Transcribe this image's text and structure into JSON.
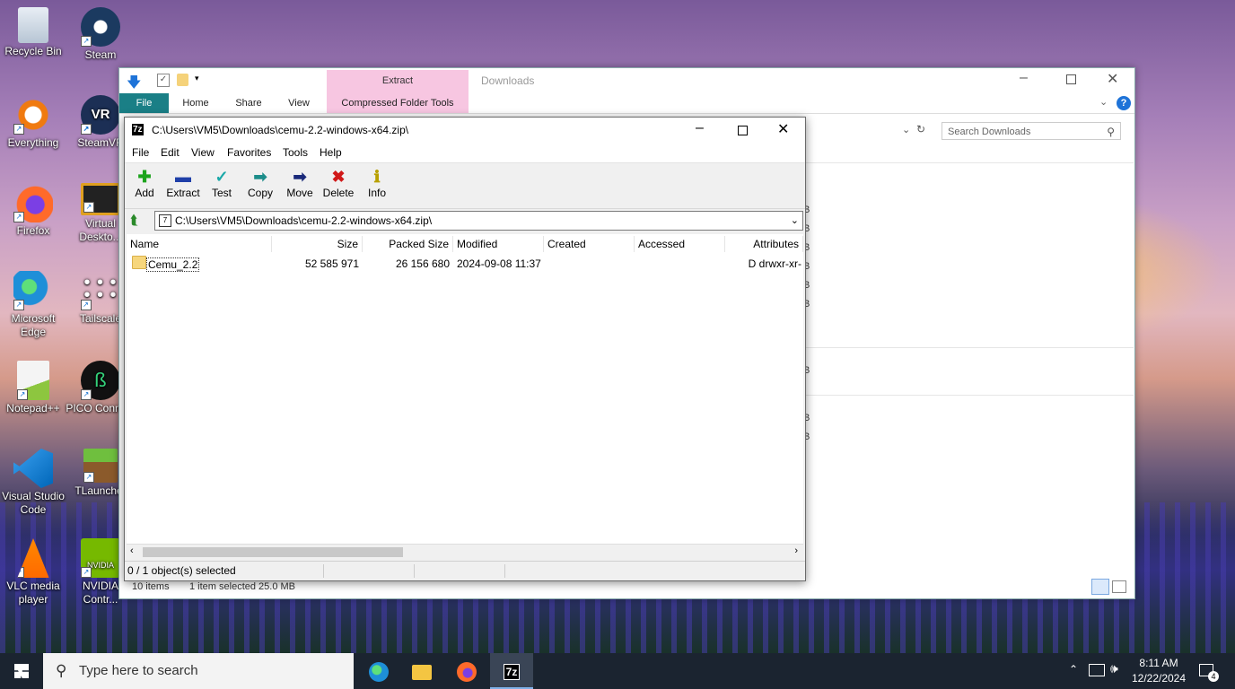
{
  "desktop_icons": [
    {
      "label": "Recycle Bin",
      "icon": "recycle-bin-icon"
    },
    {
      "label": "Steam",
      "icon": "steam-icon"
    },
    {
      "label": "Everything",
      "icon": "everything-search-icon"
    },
    {
      "label": "SteamVR",
      "icon": "steamvr-icon"
    },
    {
      "label": "Firefox",
      "icon": "firefox-icon"
    },
    {
      "label": "Virtual Deskto...",
      "icon": "virtual-desktop-icon"
    },
    {
      "label": "Microsoft Edge",
      "icon": "edge-icon"
    },
    {
      "label": "Tailscale",
      "icon": "tailscale-icon"
    },
    {
      "label": "Notepad++",
      "icon": "notepadpp-icon"
    },
    {
      "label": "PICO Connect",
      "icon": "pico-connect-icon"
    },
    {
      "label": "Visual Studio Code",
      "icon": "vscode-icon"
    },
    {
      "label": "TLauncher",
      "icon": "tlauncher-icon"
    },
    {
      "label": "VLC media player",
      "icon": "vlc-icon"
    },
    {
      "label": "NVIDIA Contr...",
      "icon": "nvidia-icon"
    }
  ],
  "explorer": {
    "title": "Downloads",
    "context_tab": "Extract",
    "tabs": [
      "File",
      "Home",
      "Share",
      "View",
      "Compressed Folder Tools"
    ],
    "search_placeholder": "Search Downloads",
    "size_fragments": [
      "B",
      "B",
      "B",
      "B",
      "B",
      "B",
      "B",
      "B",
      "B"
    ],
    "status_items": "10 items",
    "status_selected": "1 item selected  25.0 MB"
  },
  "zip": {
    "title": "C:\\Users\\VM5\\Downloads\\cemu-2.2-windows-x64.zip\\",
    "app_badge": "7z",
    "menu": [
      "File",
      "Edit",
      "View",
      "Favorites",
      "Tools",
      "Help"
    ],
    "toolbar": [
      {
        "label": "Add",
        "icon": "add-icon",
        "glyph": "✚",
        "color": "#1da41d"
      },
      {
        "label": "Extract",
        "icon": "extract-icon",
        "glyph": "▬",
        "color": "#1f3fa8"
      },
      {
        "label": "Test",
        "icon": "test-icon",
        "glyph": "✓",
        "color": "#1aa8a8"
      },
      {
        "label": "Copy",
        "icon": "copy-icon",
        "glyph": "➡",
        "color": "#1c8d8a"
      },
      {
        "label": "Move",
        "icon": "move-icon",
        "glyph": "➡",
        "color": "#1a2a7a"
      },
      {
        "label": "Delete",
        "icon": "delete-icon",
        "glyph": "✖",
        "color": "#d01818"
      },
      {
        "label": "Info",
        "icon": "info-icon",
        "glyph": "ℹ",
        "color": "#b8a000"
      }
    ],
    "address": "C:\\Users\\VM5\\Downloads\\cemu-2.2-windows-x64.zip\\",
    "columns": [
      "Name",
      "Size",
      "Packed Size",
      "Modified",
      "Created",
      "Accessed",
      "Attributes"
    ],
    "rows": [
      {
        "name": "Cemu_2.2",
        "size": "52 585 971",
        "packed": "26 156 680",
        "modified": "2024-09-08 11:37",
        "created": "",
        "accessed": "",
        "attributes": "D drwxr-xr-"
      }
    ],
    "status": "0 / 1 object(s) selected"
  },
  "taskbar": {
    "search_placeholder": "Type here to search",
    "time": "8:11 AM",
    "date": "12/22/2024",
    "notifications": "4"
  }
}
